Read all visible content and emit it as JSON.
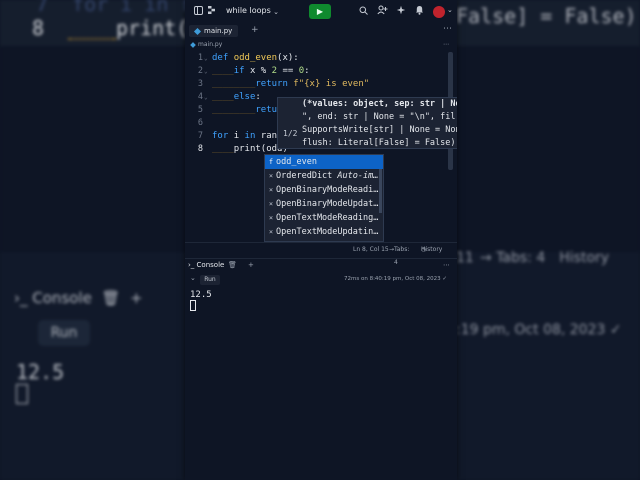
{
  "background": {
    "line7_num": "7",
    "line7_text": "for i in ra",
    "line8_num": "8",
    "line8_text": "print(",
    "false_text": "False] = False)",
    "tabs_text": "Tabs: 4",
    "history_text": "History",
    "line_col_frag": "11",
    "console_label": "Console",
    "run_label": "Run",
    "time_text": ":19 pm, Oct 08, 2023",
    "output": "12.5"
  },
  "topbar": {
    "repl_name": "while loops",
    "run_icon": "play-icon",
    "accent": "#0f8a2e"
  },
  "tabs": {
    "file_tab": "main.py",
    "plus": "+",
    "more": "⋯"
  },
  "breadcrumb": {
    "file": "main.py",
    "more": "⋯"
  },
  "editor": {
    "line_numbers": [
      "1",
      "2",
      "3",
      "4",
      "5",
      "6",
      "7",
      "8"
    ],
    "current_line": 8,
    "lines": {
      "l1_kw": "def ",
      "l1_fn": "odd_even",
      "l1_rest": "(x):",
      "l2_ind": "____",
      "l2_kw": "if ",
      "l2_a": "x % ",
      "l2_num": "2",
      "l2_b": " == ",
      "l2_num2": "0",
      "l2_c": ":",
      "l3_ind": "________",
      "l3_kw": "return ",
      "l3_str": "f\"{x} is even\"",
      "l4_ind": "____",
      "l4_kw": "else",
      "l4_c": ":",
      "l5_ind": "________",
      "l5_kw": "retur",
      "l7_kw": "for ",
      "l7_a": "i ",
      "l7_kw2": "in ",
      "l7_b": "rang",
      "l8_ind": "____",
      "l8_a": "print(odd)"
    }
  },
  "signature_help": {
    "line1": "(*values: object, sep: str | No",
    "line2": "\", end: str | None = \"\\n\", fil",
    "line3": "SupportsWrite[str] | None = Non",
    "line4": "flush: Literal[False] = False)",
    "count": "1/2"
  },
  "autocomplete": {
    "items": [
      {
        "kind": "f",
        "text": "odd_even",
        "tail": ""
      },
      {
        "kind": "×",
        "text": "OrderedDict ",
        "tail": "Auto-im…"
      },
      {
        "kind": "×",
        "text": "OpenBinaryModeReadi…",
        "tail": ""
      },
      {
        "kind": "×",
        "text": "OpenBinaryModeUpdat…",
        "tail": ""
      },
      {
        "kind": "×",
        "text": "OpenTextModeReading…",
        "tail": ""
      },
      {
        "kind": "×",
        "text": "OpenTextModeUpdatin…",
        "tail": ""
      }
    ]
  },
  "status": {
    "line_col": "Ln 8, Col 15",
    "tabs": "Tabs: 4",
    "history": "History"
  },
  "console": {
    "title": "Console",
    "plus": "+",
    "more": "⋯",
    "run_label": "Run",
    "timestamp": "72ms on 8:40:19 pm, Oct 08, 2023",
    "output": "12.5"
  }
}
